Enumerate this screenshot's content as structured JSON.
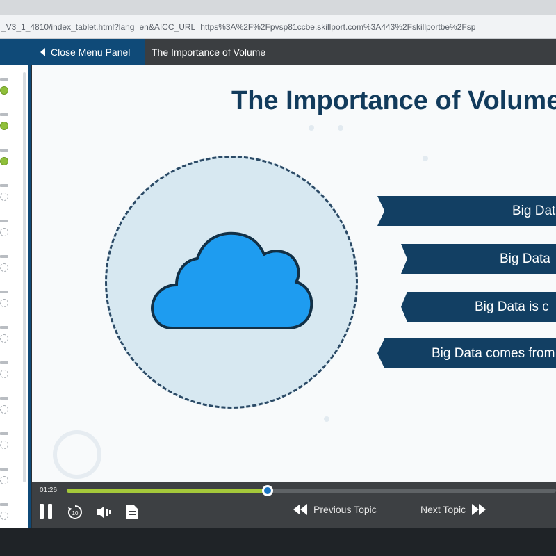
{
  "browser": {
    "url": "_V3_1_4810/index_tablet.html?lang=en&AICC_URL=https%3A%2F%2Fpvsp81ccbe.skillport.com%3A443%2Fskillportbe%2Fsp"
  },
  "header": {
    "close_menu_label": "Close Menu Panel",
    "topic_title": "The Importance of Volume"
  },
  "slide": {
    "title": "The Importance of Volume",
    "banners": [
      "Big Dat",
      "Big Data",
      "Big Data is c",
      "Big Data comes from"
    ],
    "colors": {
      "title": "#123b5c",
      "banner": "#123f63",
      "circle_fill": "#d7e8f1",
      "cloud": "#1e9cf0"
    },
    "icon": "cloud-icon"
  },
  "sidebar": {
    "items": [
      {
        "status": "complete"
      },
      {
        "status": "complete"
      },
      {
        "status": "complete"
      },
      {
        "status": "incomplete"
      },
      {
        "status": "incomplete"
      },
      {
        "status": "incomplete"
      },
      {
        "status": "incomplete"
      },
      {
        "status": "incomplete"
      },
      {
        "status": "incomplete"
      },
      {
        "status": "incomplete"
      },
      {
        "status": "incomplete"
      },
      {
        "status": "incomplete"
      },
      {
        "status": "incomplete"
      }
    ]
  },
  "player": {
    "elapsed": "01:26",
    "progress": 0.41,
    "progress_color": "#a4c93a",
    "previous_label": "Previous Topic",
    "next_label": "Next Topic",
    "icons": [
      "pause-icon",
      "replay-10-icon",
      "volume-icon",
      "transcript-icon"
    ]
  }
}
